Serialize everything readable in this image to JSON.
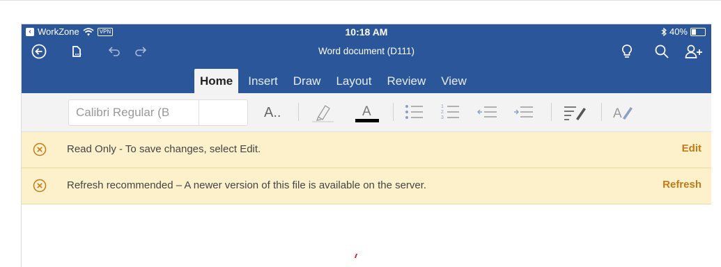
{
  "status": {
    "app_name": "WorkZone",
    "vpn_label": "VPN",
    "time": "10:18 AM",
    "battery_percent": "40%",
    "battery_level": 0.4
  },
  "toolbar": {
    "document_title": "Word document (D111)",
    "icons": [
      "back-circle-icon",
      "file-menu-icon",
      "undo-icon",
      "redo-icon",
      "lightbulb-icon",
      "search-icon",
      "share-person-icon"
    ]
  },
  "tabs": [
    {
      "label": "Home",
      "active": true
    },
    {
      "label": "Insert",
      "active": false
    },
    {
      "label": "Draw",
      "active": false
    },
    {
      "label": "Layout",
      "active": false
    },
    {
      "label": "Review",
      "active": false
    },
    {
      "label": "View",
      "active": false
    }
  ],
  "ribbon": {
    "font_name": "Calibri Regular (B",
    "font_size_label": "A..",
    "font_color_label": "A",
    "styles_label": "A"
  },
  "banners": [
    {
      "message": "Read Only - To save changes, select Edit.",
      "action": "Edit"
    },
    {
      "message": "Refresh recommended – A newer version of this file is available on the server.",
      "action": "Refresh"
    }
  ],
  "colors": {
    "header_blue": "#2b579a",
    "banner_yellow": "#fdf1cc",
    "action_orange": "#c07a17",
    "font_color_bar": "#000000"
  }
}
